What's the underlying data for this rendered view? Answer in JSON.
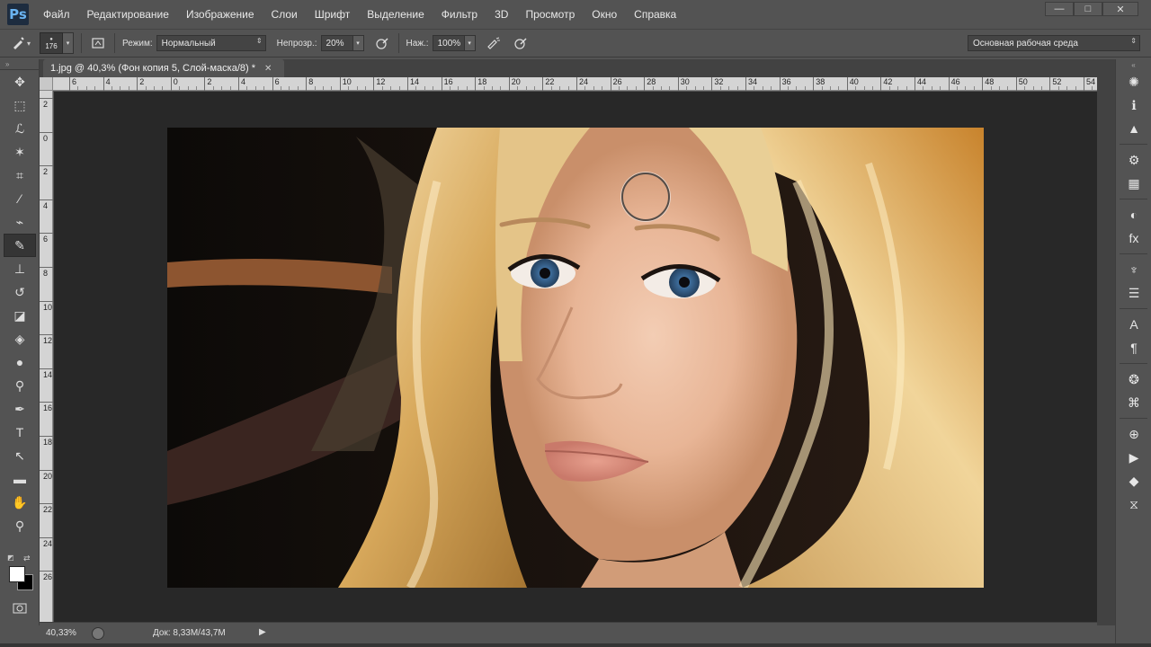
{
  "app": {
    "logo": "Ps",
    "menu": [
      "Файл",
      "Редактирование",
      "Изображение",
      "Слои",
      "Шрифт",
      "Выделение",
      "Фильтр",
      "3D",
      "Просмотр",
      "Окно",
      "Справка"
    ],
    "window_controls": {
      "minimize": "—",
      "maximize": "□",
      "close": "✕"
    }
  },
  "options_bar": {
    "brush_size": "176",
    "mode_label": "Режим:",
    "mode_value": "Нормальный",
    "opacity_label": "Непрозр.:",
    "opacity_value": "20%",
    "pressure_label": "Наж.:",
    "pressure_value": "100%",
    "workspace": "Основная рабочая среда"
  },
  "document": {
    "tab_title": "1.jpg @ 40,3% (Фон копия 5, Слой-маска/8) *",
    "tab_close": "✕"
  },
  "rulers": {
    "horizontal": [
      "6",
      "4",
      "2",
      "0",
      "2",
      "4",
      "6",
      "8",
      "10",
      "12",
      "14",
      "16",
      "18",
      "20",
      "22",
      "24",
      "26",
      "28",
      "30",
      "32",
      "34",
      "36",
      "38",
      "40",
      "42",
      "44",
      "46",
      "48",
      "50",
      "52",
      "54"
    ],
    "vertical": [
      "2",
      "0",
      "2",
      "4",
      "6",
      "8",
      "10",
      "12",
      "14",
      "16",
      "18",
      "20",
      "22",
      "24",
      "26"
    ]
  },
  "tools": [
    {
      "name": "move-tool",
      "glyph": "✥",
      "active": false
    },
    {
      "name": "marquee-tool",
      "glyph": "⬚",
      "active": false
    },
    {
      "name": "lasso-tool",
      "glyph": "ℒ",
      "active": false
    },
    {
      "name": "magic-wand-tool",
      "glyph": "✶",
      "active": false
    },
    {
      "name": "crop-tool",
      "glyph": "⌗",
      "active": false
    },
    {
      "name": "eyedropper-tool",
      "glyph": "⁄",
      "active": false
    },
    {
      "name": "healing-brush-tool",
      "glyph": "⌁",
      "active": false
    },
    {
      "name": "brush-tool",
      "glyph": "✎",
      "active": true
    },
    {
      "name": "clone-stamp-tool",
      "glyph": "⊥",
      "active": false
    },
    {
      "name": "history-brush-tool",
      "glyph": "↺",
      "active": false
    },
    {
      "name": "eraser-tool",
      "glyph": "◪",
      "active": false
    },
    {
      "name": "paint-bucket-tool",
      "glyph": "◈",
      "active": false
    },
    {
      "name": "blur-tool",
      "glyph": "●",
      "active": false
    },
    {
      "name": "dodge-tool",
      "glyph": "⚲",
      "active": false
    },
    {
      "name": "pen-tool",
      "glyph": "✒",
      "active": false
    },
    {
      "name": "type-tool",
      "glyph": "T",
      "active": false
    },
    {
      "name": "path-selection-tool",
      "glyph": "↖",
      "active": false
    },
    {
      "name": "rectangle-tool",
      "glyph": "▬",
      "active": false
    },
    {
      "name": "hand-tool",
      "glyph": "✋",
      "active": false
    },
    {
      "name": "zoom-tool",
      "glyph": "⚲",
      "active": false
    }
  ],
  "colors": {
    "foreground": "#ffffff",
    "background": "#000000"
  },
  "panel_icons": [
    {
      "name": "color-panel-icon",
      "glyph": "✺"
    },
    {
      "name": "info-panel-icon",
      "glyph": "ℹ"
    },
    {
      "name": "histogram-panel-icon",
      "glyph": "▲"
    },
    {
      "name": "adjustments-panel-icon",
      "glyph": "⚙"
    },
    {
      "name": "swatches-panel-icon",
      "glyph": "▦"
    },
    {
      "name": "styles-panel-icon",
      "glyph": "◐"
    },
    {
      "name": "fx-panel-icon",
      "glyph": "fx"
    },
    {
      "name": "brush-presets-panel-icon",
      "glyph": "♆"
    },
    {
      "name": "brush-settings-panel-icon",
      "glyph": "☰"
    },
    {
      "name": "character-panel-icon",
      "glyph": "A"
    },
    {
      "name": "paragraph-panel-icon",
      "glyph": "¶"
    },
    {
      "name": "channels-panel-icon",
      "glyph": "❂"
    },
    {
      "name": "paths-panel-icon",
      "glyph": "⌘"
    },
    {
      "name": "clone-source-panel-icon",
      "glyph": "⊕"
    },
    {
      "name": "actions-panel-icon",
      "glyph": "▶"
    },
    {
      "name": "layers-panel-icon",
      "glyph": "◆"
    },
    {
      "name": "history-panel-icon",
      "glyph": "⧖"
    }
  ],
  "status_bar": {
    "zoom": "40,33%",
    "doc_size": "Док: 8,33M/43,7M",
    "arrow": "▶"
  }
}
